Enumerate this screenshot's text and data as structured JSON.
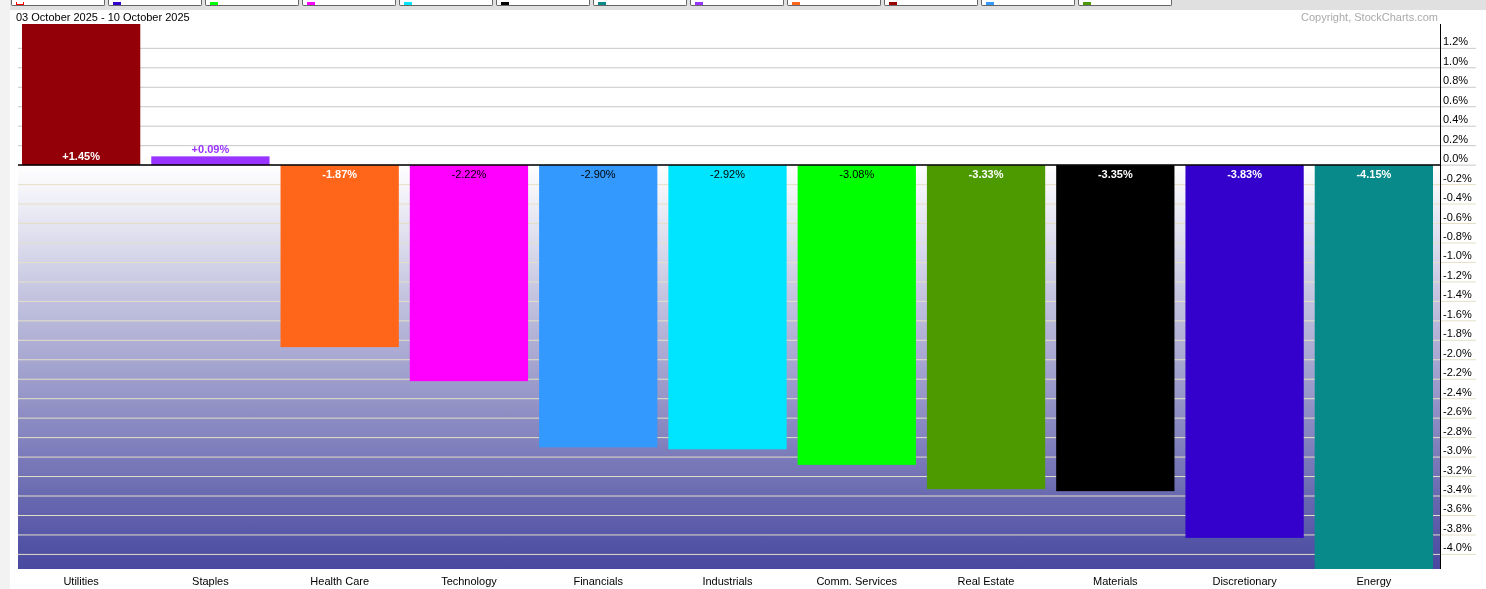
{
  "legend_buttons": [
    {
      "color": "#ff0000",
      "kind": "outline"
    },
    {
      "color": "#3300cc",
      "kind": "fill"
    },
    {
      "color": "#00ff00",
      "kind": "fill"
    },
    {
      "color": "#ff00ff",
      "kind": "fill"
    },
    {
      "color": "#00e5ff",
      "kind": "fill"
    },
    {
      "color": "#000000",
      "kind": "fill"
    },
    {
      "color": "#088a8a",
      "kind": "fill"
    },
    {
      "color": "#9933ff",
      "kind": "fill"
    },
    {
      "color": "#ff6619",
      "kind": "fill"
    },
    {
      "color": "#990000",
      "kind": "fill"
    },
    {
      "color": "#3399ff",
      "kind": "fill"
    },
    {
      "color": "#4d9900",
      "kind": "fill"
    }
  ],
  "period": "03 October 2025 - 10 October 2025",
  "copyright": "Copyright, StockCharts.com",
  "chart_data": {
    "type": "bar",
    "categories": [
      "Utilities",
      "Staples",
      "Health Care",
      "Technology",
      "Financials",
      "Industrials",
      "Comm. Services",
      "Real Estate",
      "Materials",
      "Discretionary",
      "Energy"
    ],
    "grid": true,
    "bands": [
      {
        "axis": "y",
        "from": -4.15,
        "to": 0
      }
    ],
    "series": [
      {
        "colors": [
          "#930008",
          "#9933ff",
          "#ff6619",
          "#ff00ff",
          "#3399ff",
          "#00e5ff",
          "#00ff00",
          "#4d9900",
          "#000000",
          "#3300cc",
          "#088a8a"
        ],
        "values": [
          1.45,
          0.09,
          -1.87,
          -2.22,
          -2.9,
          -2.92,
          -3.08,
          -3.33,
          -3.35,
          -3.83,
          -4.15
        ]
      }
    ],
    "value_labels": [
      "+1.45%",
      "+0.09%",
      "-1.87%",
      "-2.22%",
      "-2.90%",
      "-2.92%",
      "-3.08%",
      "-3.33%",
      "-3.35%",
      "-3.83%",
      "-4.15%"
    ],
    "ylim": [
      -4.15,
      1.45
    ],
    "yticks": [
      {
        "value": 1.2,
        "label": "1.2%"
      },
      {
        "value": 1.0,
        "label": "1.0%"
      },
      {
        "value": 0.8,
        "label": "0.8%"
      },
      {
        "value": 0.6,
        "label": "0.6%"
      },
      {
        "value": 0.4,
        "label": "0.4%"
      },
      {
        "value": 0.2,
        "label": "0.2%"
      },
      {
        "value": 0,
        "label": "0.0%"
      },
      {
        "value": -0.2,
        "label": "-0.2%"
      },
      {
        "value": -0.4,
        "label": "-0.4%"
      },
      {
        "value": -0.6,
        "label": "-0.6%"
      },
      {
        "value": -0.8,
        "label": "-0.8%"
      },
      {
        "value": -1.0,
        "label": "-1.0%"
      },
      {
        "value": -1.2,
        "label": "-1.2%"
      },
      {
        "value": -1.4,
        "label": "-1.4%"
      },
      {
        "value": -1.6,
        "label": "-1.6%"
      },
      {
        "value": -1.8,
        "label": "-1.8%"
      },
      {
        "value": -2.0,
        "label": "-2.0%"
      },
      {
        "value": -2.2,
        "label": "-2.2%"
      },
      {
        "value": -2.4,
        "label": "-2.4%"
      },
      {
        "value": -2.6,
        "label": "-2.6%"
      },
      {
        "value": -2.8,
        "label": "-2.8%"
      },
      {
        "value": -3.0,
        "label": "-3.0%"
      },
      {
        "value": -3.2,
        "label": "-3.2%"
      },
      {
        "value": -3.4,
        "label": "-3.4%"
      },
      {
        "value": -3.6,
        "label": "-3.6%"
      },
      {
        "value": -3.8,
        "label": "-3.8%"
      },
      {
        "value": -4.0,
        "label": "-4.0%"
      }
    ]
  }
}
